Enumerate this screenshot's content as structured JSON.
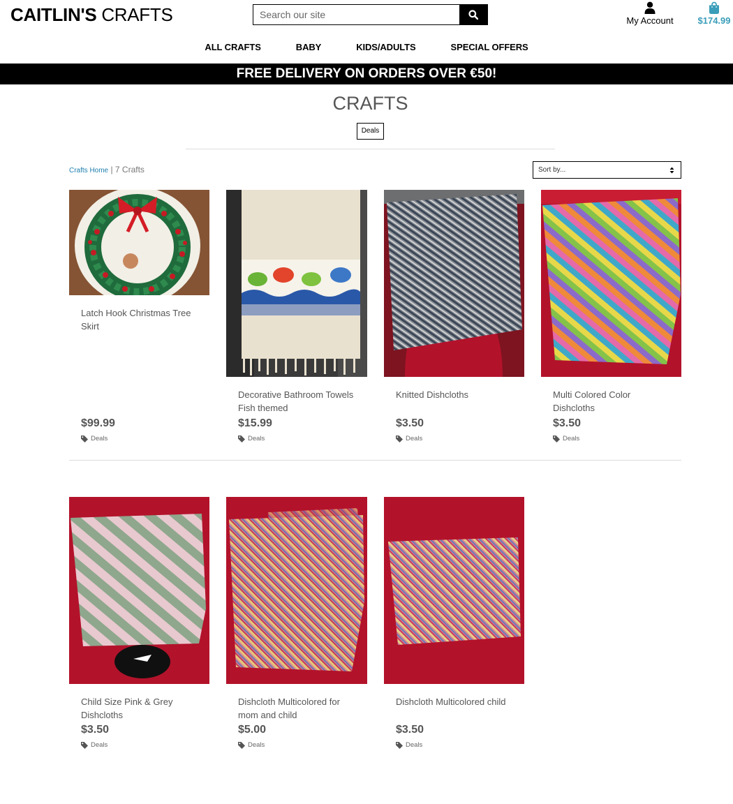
{
  "header": {
    "logo_bold": "CAITLIN'S",
    "logo_light": "CRAFTS",
    "search_placeholder": "Search our site",
    "account_label": "My Account",
    "cart_total": "$174.99"
  },
  "nav": [
    "ALL CRAFTS",
    "BABY",
    "KIDS/ADULTS",
    "SPECIAL OFFERS"
  ],
  "banner": "FREE DELIVERY ON ORDERS OVER €50!",
  "page": {
    "title": "CRAFTS",
    "category_pill": "Deals",
    "breadcrumb_link": "Crafts Home",
    "breadcrumb_sep": " | ",
    "count": "7 Crafts",
    "sort_label": "Sort by..."
  },
  "products": [
    {
      "title": "Latch Hook Christmas Tree Skirt",
      "price": "$99.99",
      "tag": "Deals"
    },
    {
      "title": "Decorative Bathroom Towels Fish themed",
      "price": "$15.99",
      "tag": "Deals"
    },
    {
      "title": "Knitted Dishcloths",
      "price": "$3.50",
      "tag": "Deals"
    },
    {
      "title": "Multi Colored Color Dishcloths",
      "price": "$3.50",
      "tag": "Deals"
    },
    {
      "title": "Child Size Pink & Grey Dishcloths",
      "price": "$3.50",
      "tag": "Deals"
    },
    {
      "title": "Dishcloth Multicolored for mom and child",
      "price": "$5.00",
      "tag": "Deals"
    },
    {
      "title": "Dishcloth Multicolored child",
      "price": "$3.50",
      "tag": "Deals"
    }
  ],
  "colors": {
    "accent": "#3a9dba",
    "link": "#1e7fae",
    "banner_bg": "#000000",
    "mannequin_red": "#b3122b"
  },
  "icons": [
    "search-icon",
    "user-icon",
    "shopping-bag-icon",
    "chevron-updown-icon",
    "tag-icon"
  ]
}
